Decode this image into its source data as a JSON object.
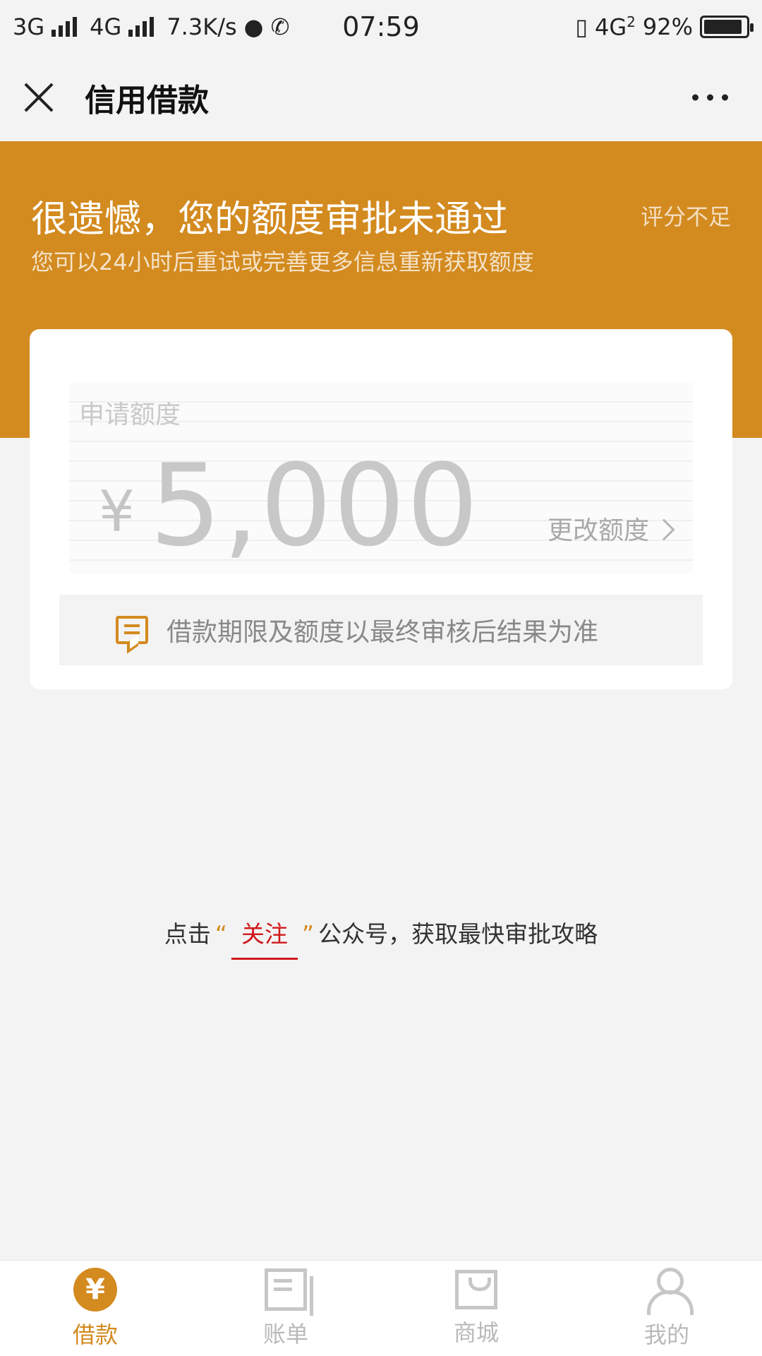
{
  "status_bar": {
    "network1": "3G",
    "network2": "4G",
    "speed": "7.3K/s",
    "time": "07:59",
    "network3": "4G",
    "sim_badge": "2",
    "battery": "92%",
    "battery_level": 0.92
  },
  "nav": {
    "title": "信用借款"
  },
  "banner": {
    "title": "很遗憾，您的额度审批未通过",
    "tag": "评分不足",
    "subtitle": "您可以24小时后重试或完善更多信息重新获取额度"
  },
  "card": {
    "label": "申请额度",
    "currency": "¥",
    "amount": "5,000",
    "change_label": "更改额度",
    "notice": "借款期限及额度以最终审核后结果为准"
  },
  "follow": {
    "prefix": "点击",
    "quote_open": "“",
    "link": "关注",
    "quote_close": "”",
    "suffix": "公众号，获取最快审批攻略"
  },
  "tabs": [
    {
      "label": "借款",
      "icon": "yen-icon",
      "active": true
    },
    {
      "label": "账单",
      "icon": "bill-icon",
      "active": false
    },
    {
      "label": "商城",
      "icon": "shop-icon",
      "active": false
    },
    {
      "label": "我的",
      "icon": "user-icon",
      "active": false
    }
  ],
  "colors": {
    "brand": "#d38a1f",
    "link_red": "#d0191c",
    "background": "#f3f3f3"
  }
}
